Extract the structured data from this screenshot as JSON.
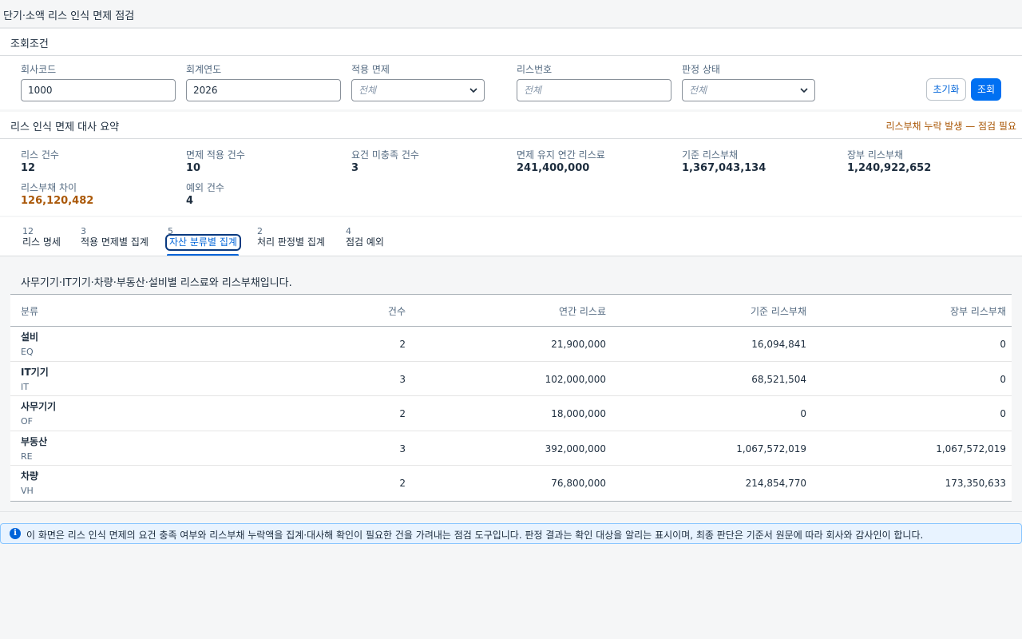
{
  "page": {
    "title": "단기·소액 리스 인식 면제 점검"
  },
  "filters": {
    "section_title": "조회조건",
    "company_code": {
      "label": "회사코드",
      "value": "1000"
    },
    "fiscal_year": {
      "label": "회계연도",
      "value": "2026"
    },
    "exemption": {
      "label": "적용 면제",
      "value": "전체"
    },
    "lease_no": {
      "label": "리스번호",
      "placeholder": "전체"
    },
    "status": {
      "label": "판정 상태",
      "value": "전체"
    },
    "reset_label": "초기화",
    "search_label": "조회"
  },
  "summary": {
    "title": "리스 인식 면제 대사 요약",
    "alert": "리스부채 누락 발생 — 점검 필요",
    "kpis": [
      {
        "label": "리스 건수",
        "value": "12"
      },
      {
        "label": "면제 적용 건수",
        "value": "10"
      },
      {
        "label": "요건 미충족 건수",
        "value": "3"
      },
      {
        "label": "면제 유지 연간 리스료",
        "value": "241,400,000"
      },
      {
        "label": "기준 리스부채",
        "value": "1,367,043,134"
      },
      {
        "label": "장부 리스부채",
        "value": "1,240,922,652"
      },
      {
        "label": "리스부채 차이",
        "value": "126,120,482"
      },
      {
        "label": "예외 건수",
        "value": "4"
      }
    ]
  },
  "tabs": [
    {
      "count": "12",
      "label": "리스 명세"
    },
    {
      "count": "3",
      "label": "적용 면제별 집계"
    },
    {
      "count": "5",
      "label": "자산 분류별 집계"
    },
    {
      "count": "2",
      "label": "처리 판정별 집계"
    },
    {
      "count": "4",
      "label": "점검 예외"
    }
  ],
  "content": {
    "description": "사무기기·IT기기·차량·부동산·설비별 리스료와 리스부채입니다.",
    "columns": [
      "분류",
      "건수",
      "연간 리스료",
      "기준 리스부채",
      "장부 리스부채"
    ],
    "rows": [
      {
        "name": "설비",
        "code": "EQ",
        "count": "2",
        "annual": "21,900,000",
        "base": "16,094,841",
        "book": "0"
      },
      {
        "name": "IT기기",
        "code": "IT",
        "count": "3",
        "annual": "102,000,000",
        "base": "68,521,504",
        "book": "0"
      },
      {
        "name": "사무기기",
        "code": "OF",
        "count": "2",
        "annual": "18,000,000",
        "base": "0",
        "book": "0"
      },
      {
        "name": "부동산",
        "code": "RE",
        "count": "3",
        "annual": "392,000,000",
        "base": "1,067,572,019",
        "book": "1,067,572,019"
      },
      {
        "name": "차량",
        "code": "VH",
        "count": "2",
        "annual": "76,800,000",
        "base": "214,854,770",
        "book": "173,350,633"
      }
    ]
  },
  "info": {
    "icon": "info-icon",
    "text": "이 화면은 리스 인식 면제의 요건 충족 여부와 리스부채 누락액을 집계·대사해 확인이 필요한 건을 가려내는 점검 도구입니다. 판정 결과는 확인 대상을 알리는 표시이며, 최종 판단은 기준서 원문에 따라 회사와 감사인이 합니다."
  },
  "colors": {
    "accent": "#0070f2",
    "warning": "#aa5808"
  }
}
